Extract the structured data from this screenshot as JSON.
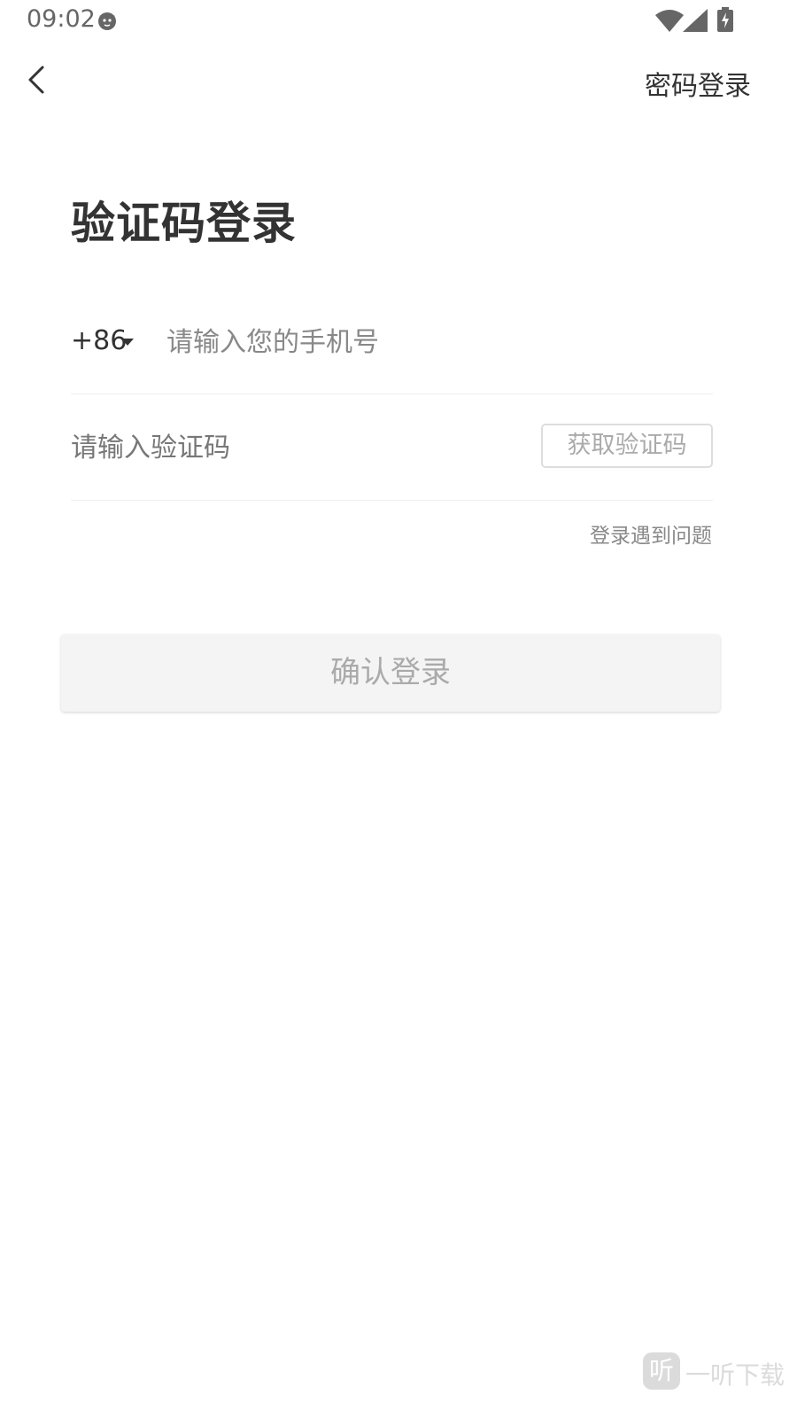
{
  "status_bar": {
    "time": "09:02"
  },
  "nav": {
    "right_link": "密码登录"
  },
  "page": {
    "title": "验证码登录"
  },
  "phone": {
    "country_code": "+86",
    "placeholder": "请输入您的手机号",
    "value": ""
  },
  "code": {
    "placeholder": "请输入验证码",
    "value": "",
    "get_code_label": "获取验证码"
  },
  "help_link": "登录遇到问题",
  "confirm_label": "确认登录",
  "watermark": {
    "logo_char": "听",
    "text": "一听下载"
  },
  "colors": {
    "text_primary": "#333333",
    "placeholder": "#888888",
    "disabled": "#aaaaaa",
    "button_bg": "#f4f4f4",
    "divider": "#eeeeee"
  },
  "icons": [
    "cat-notification-icon",
    "wifi-icon",
    "signal-icon",
    "battery-charging-icon",
    "back-arrow-icon",
    "caret-down-icon"
  ]
}
